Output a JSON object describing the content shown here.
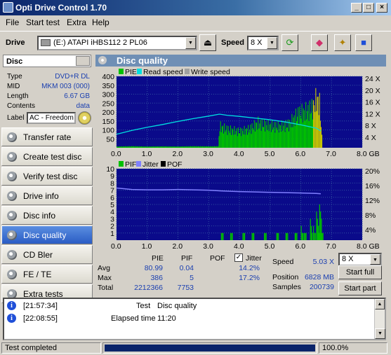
{
  "window": {
    "title": "Opti Drive Control 1.70",
    "controls": [
      "_",
      "□",
      "×"
    ]
  },
  "menu": [
    "File",
    "Start test",
    "Extra",
    "Help"
  ],
  "drivebar": {
    "drive_label": "Drive",
    "drive_value": "(E:)   ATAPI iHBS112   2 PL06",
    "speed_label": "Speed",
    "speed_value": "8 X"
  },
  "disc": {
    "header": "Disc",
    "rows": [
      {
        "k": "Type",
        "v": "DVD+R DL"
      },
      {
        "k": "MID",
        "v": "MKM 003 (000)"
      },
      {
        "k": "Length",
        "v": "6.67 GB"
      },
      {
        "k": "Contents",
        "v": "data"
      }
    ],
    "label_key": "Label",
    "label_value": "AC - Freedom"
  },
  "nav": [
    {
      "label": "Transfer rate",
      "active": false
    },
    {
      "label": "Create test disc",
      "active": false
    },
    {
      "label": "Verify test disc",
      "active": false
    },
    {
      "label": "Drive info",
      "active": false
    },
    {
      "label": "Disc info",
      "active": false
    },
    {
      "label": "Disc quality",
      "active": true
    },
    {
      "label": "CD Bler",
      "active": false
    },
    {
      "label": "FE / TE",
      "active": false
    },
    {
      "label": "Extra tests",
      "active": false
    }
  ],
  "panel_title": "Disc quality",
  "chart_data": [
    {
      "type": "bar",
      "legend": [
        "PIE",
        "Read speed",
        "Write speed"
      ],
      "legend_colors": [
        "#00c000",
        "#00e0e0",
        "#a0a0a0"
      ],
      "x_ticks": [
        "0.0",
        "1.0",
        "2.0",
        "3.0",
        "4.0",
        "5.0",
        "6.0",
        "7.0",
        "8.0 GB"
      ],
      "y_left_ticks": [
        "400",
        "350",
        "300",
        "250",
        "200",
        "150",
        "100",
        "50"
      ],
      "y_right_ticks": [
        "24 X",
        "20 X",
        "16 X",
        "12 X",
        "8 X",
        "4 X"
      ],
      "xlim": [
        0,
        8
      ],
      "ylim": [
        0,
        400
      ],
      "pie_points": [
        [
          0.0,
          8
        ],
        [
          0.5,
          10
        ],
        [
          1.0,
          8
        ],
        [
          1.5,
          9
        ],
        [
          2.0,
          8
        ],
        [
          2.5,
          10
        ],
        [
          3.0,
          9
        ],
        [
          3.3,
          10
        ],
        [
          3.35,
          150
        ],
        [
          3.6,
          130
        ],
        [
          4.0,
          115
        ],
        [
          4.3,
          130
        ],
        [
          4.6,
          175
        ],
        [
          5.0,
          155
        ],
        [
          5.3,
          150
        ],
        [
          5.6,
          165
        ],
        [
          5.9,
          240
        ],
        [
          6.2,
          260
        ],
        [
          6.4,
          290
        ],
        [
          6.5,
          350
        ],
        [
          6.6,
          310
        ],
        [
          6.7,
          0
        ]
      ],
      "read_speed_points": [
        [
          0.0,
          4.8
        ],
        [
          0.5,
          6.2
        ],
        [
          1.0,
          7.3
        ],
        [
          1.5,
          8.3
        ],
        [
          2.0,
          9.4
        ],
        [
          2.5,
          10.4
        ],
        [
          3.0,
          11.3
        ],
        [
          3.35,
          12.0
        ],
        [
          3.6,
          11.6
        ],
        [
          4.0,
          11.2
        ],
        [
          4.5,
          10.6
        ],
        [
          5.0,
          10.0
        ],
        [
          5.5,
          9.2
        ],
        [
          6.0,
          8.2
        ],
        [
          6.5,
          7.0
        ],
        [
          6.65,
          6.0
        ]
      ],
      "x_unit": "GB"
    },
    {
      "type": "bar",
      "legend": [
        "PIF",
        "Jitter",
        "POF"
      ],
      "legend_colors": [
        "#00c000",
        "#8080ff",
        "#000000"
      ],
      "x_ticks": [
        "0.0",
        "1.0",
        "2.0",
        "3.0",
        "4.0",
        "5.0",
        "6.0",
        "7.0",
        "8.0 GB"
      ],
      "y_left_ticks": [
        "10",
        "9",
        "8",
        "7",
        "6",
        "5",
        "4",
        "3",
        "2",
        "1"
      ],
      "y_right_ticks": [
        "20%",
        "16%",
        "12%",
        "8%",
        "4%"
      ],
      "xlim": [
        0,
        8
      ],
      "ylim": [
        0,
        10
      ],
      "pif_points": [
        [
          3.4,
          1
        ],
        [
          3.7,
          1
        ],
        [
          4.1,
          1
        ],
        [
          4.4,
          1
        ],
        [
          4.8,
          1
        ],
        [
          5.2,
          1
        ],
        [
          5.5,
          1
        ],
        [
          5.8,
          1
        ],
        [
          6.0,
          2
        ],
        [
          6.1,
          1
        ],
        [
          6.3,
          3
        ],
        [
          6.4,
          2
        ],
        [
          6.5,
          4
        ],
        [
          6.55,
          2
        ],
        [
          6.6,
          5
        ],
        [
          6.65,
          1
        ]
      ],
      "jitter_points": [
        [
          0.0,
          14.6
        ],
        [
          0.5,
          14.2
        ],
        [
          1.0,
          14.1
        ],
        [
          1.5,
          14.1
        ],
        [
          2.0,
          14.2
        ],
        [
          2.5,
          14.1
        ],
        [
          3.0,
          14.0
        ],
        [
          3.4,
          13.8
        ],
        [
          4.0,
          13.6
        ],
        [
          4.5,
          13.5
        ],
        [
          5.0,
          13.4
        ],
        [
          5.5,
          13.3
        ],
        [
          6.0,
          13.2
        ],
        [
          6.5,
          13.1
        ],
        [
          6.65,
          13.0
        ]
      ],
      "x_unit": "GB"
    }
  ],
  "stats": {
    "headers": [
      "PIE",
      "PIF",
      "POF"
    ],
    "jitter_label": "Jitter",
    "rows": [
      {
        "label": "Avg",
        "pie": "80.99",
        "pif": "0.04",
        "pof": "",
        "jitter": "14.2%"
      },
      {
        "label": "Max",
        "pie": "386",
        "pif": "5",
        "pof": "",
        "jitter": "17.2%"
      },
      {
        "label": "Total",
        "pie": "2212366",
        "pif": "7753",
        "pof": "",
        "jitter": ""
      }
    ],
    "speed_label": "Speed",
    "speed_value": "5.03 X",
    "position_label": "Position",
    "position_value": "6828 MB",
    "samples_label": "Samples",
    "samples_value": "200739",
    "speed_select": "8 X",
    "start_full": "Start full",
    "start_part": "Start part"
  },
  "log": [
    {
      "time": "[21:57:34]",
      "key": "Test",
      "value": "Disc quality"
    },
    {
      "time": "[22:08:55]",
      "key": "Elapsed time",
      "value": "11:20"
    }
  ],
  "status": {
    "text": "Test completed",
    "progress_percent": 100,
    "progress_label": "100.0%"
  }
}
